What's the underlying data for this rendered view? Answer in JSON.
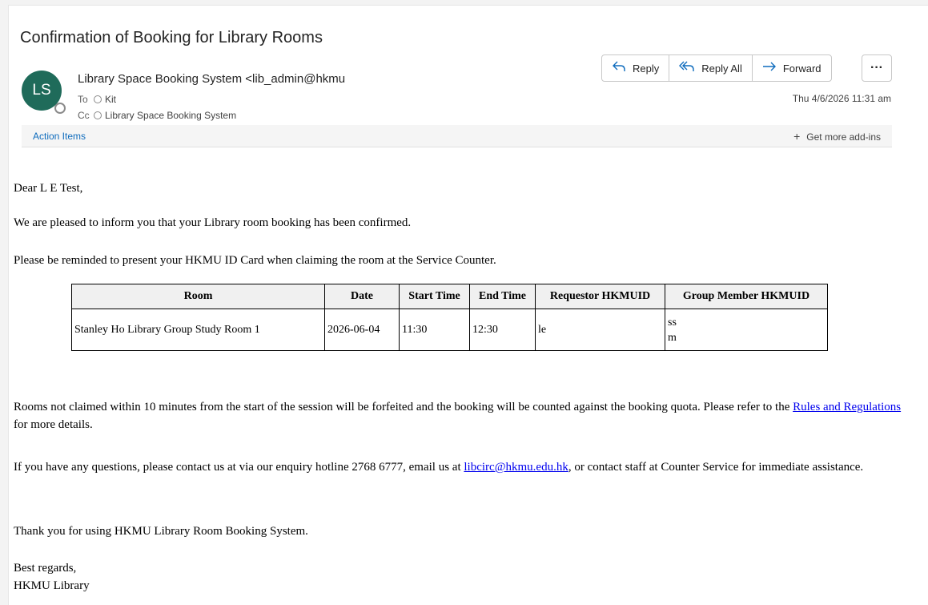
{
  "email": {
    "subject": "Confirmation of Booking for Library Rooms",
    "avatar_initials": "LS",
    "sender": "Library Space Booking System <lib_admin@hkmu",
    "to_label": "To",
    "to_name": "Kit",
    "cc_label": "Cc",
    "cc_name": "Library Space Booking System",
    "timestamp": "Thu 4/6/2026 11:31 am"
  },
  "actions": {
    "reply": "Reply",
    "reply_all": "Reply All",
    "forward": "Forward",
    "more": "···"
  },
  "addin_bar": {
    "action_items": "Action Items",
    "get_addins": "Get more add-ins"
  },
  "body": {
    "greeting": "Dear L E Test,",
    "para1": "We are pleased to inform you that your Library room booking has been confirmed.",
    "para2": "Please be reminded to present your HKMU ID Card when claiming the room at the Service Counter.",
    "para3_pre": "Rooms not claimed within 10 minutes from the start of the session will be forfeited and the booking will be counted against the booking quota. Please refer to the ",
    "para3_link": "Rules and Regulations",
    "para3_post": " for more details.",
    "para4_pre": "If you have any questions, please contact us at via our enquiry hotline 2768 6777, email us at  ",
    "para4_link": "libcirc@hkmu.edu.hk",
    "para4_post": ", or contact staff at Counter Service for immediate assistance.",
    "para5": "Thank you for using HKMU Library Room Booking System.",
    "signoff1": "Best regards,",
    "signoff2": "HKMU Library"
  },
  "booking_table": {
    "headers": [
      "Room",
      "Date",
      "Start Time",
      "End Time",
      "Requestor HKMUID",
      "Group Member HKMUID"
    ],
    "row": {
      "room": "Stanley Ho Library Group Study Room 1",
      "date": "2026-06-04",
      "start": "11:30",
      "end": "12:30",
      "requestor": "le",
      "members": [
        "ss",
        "m"
      ]
    }
  },
  "colors": {
    "avatar_bg": "#1f6b5a",
    "accent": "#0f6cbd",
    "link": "#0000ee"
  },
  "icons": {
    "reply": "reply-arrow-icon",
    "reply_all": "reply-all-icon",
    "forward": "forward-arrow-icon",
    "more": "more-horizontal-icon",
    "add": "plus-icon"
  }
}
